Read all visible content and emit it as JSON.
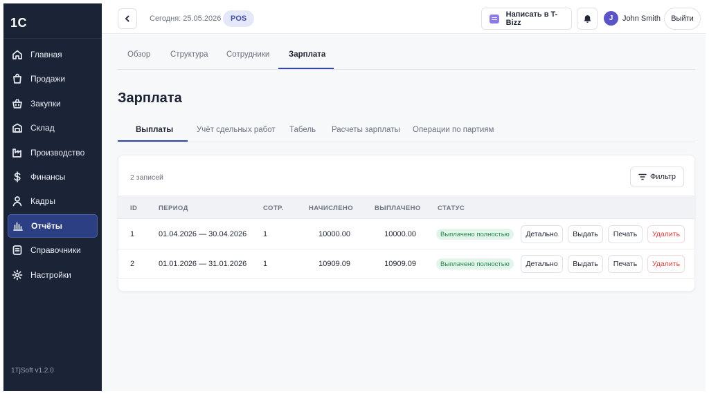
{
  "app": {
    "logo": "1С",
    "version": "1TjSoft v1.2.0"
  },
  "sidebar": {
    "items": [
      {
        "label": "Главная",
        "icon": "home-icon"
      },
      {
        "label": "Продажи",
        "icon": "shopping-bag-icon"
      },
      {
        "label": "Закупки",
        "icon": "basket-icon"
      },
      {
        "label": "Склад",
        "icon": "warehouse-icon"
      },
      {
        "label": "Производство",
        "icon": "factory-icon"
      },
      {
        "label": "Финансы",
        "icon": "dollar-icon"
      },
      {
        "label": "Кадры",
        "icon": "user-icon"
      },
      {
        "label": "Отчёты",
        "icon": "bar-chart-icon",
        "active": true
      },
      {
        "label": "Справочники",
        "icon": "document-icon"
      },
      {
        "label": "Настройки",
        "icon": "gear-icon"
      }
    ]
  },
  "topbar": {
    "date_text": "Сегодня: 25.05.2026",
    "mode_badge": "POS",
    "chat_button": "Написать в T-Bizz",
    "user_initial": "J",
    "user_name": "John Smith",
    "logout": "Выйти"
  },
  "tabs_main": [
    "Обзор",
    "Структура",
    "Сотрудники",
    "Зарплата"
  ],
  "page": {
    "title": "Зарплата"
  },
  "tabs_sub": [
    "Выплаты",
    "Учёт сдельных работ",
    "Табель",
    "Расчеты зарплаты",
    "Операции по партиям"
  ],
  "table": {
    "records": "2 записей",
    "filter": "Фильтр",
    "headers": {
      "id": "ID",
      "period": "ПЕРИОД",
      "emp": "СОТР.",
      "accrued": "НАЧИСЛЕНО",
      "paid": "ВЫПЛАЧЕНО",
      "status": "СТАТУС"
    },
    "rows": [
      {
        "id": "1",
        "period": "01.04.2026 — 30.04.2026",
        "emp": "1",
        "accrued": "10000.00",
        "paid": "10000.00",
        "status": "Выплачено полностью"
      },
      {
        "id": "2",
        "period": "01.01.2026 — 31.01.2026",
        "emp": "1",
        "accrued": "10909.09",
        "paid": "10909.09",
        "status": "Выплачено полностью"
      }
    ],
    "actions": {
      "details": "Детально",
      "issue": "Выдать",
      "print": "Печать",
      "delete": "Удалить"
    }
  },
  "colors": {
    "sidebar_bg": "#1b2437",
    "accent": "#3147a8",
    "status_green": "#238a4e",
    "danger": "#d94040"
  }
}
